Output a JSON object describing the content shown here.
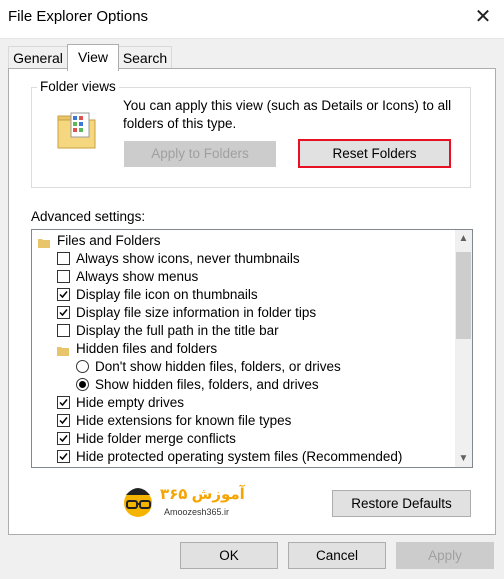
{
  "window": {
    "title": "File Explorer Options",
    "close_glyph": "✕"
  },
  "tabs": [
    {
      "label": "General",
      "active": false
    },
    {
      "label": "View",
      "active": true
    },
    {
      "label": "Search",
      "active": false
    }
  ],
  "folder_views": {
    "group_label": "Folder views",
    "description": "You can apply this view (such as Details or Icons) to all folders of this type.",
    "apply_label": "Apply to Folders",
    "reset_label": "Reset Folders",
    "highlight_color": "#e81123"
  },
  "advanced": {
    "label": "Advanced settings:",
    "items": [
      {
        "type": "folder",
        "label": "Files and Folders"
      },
      {
        "type": "checkbox",
        "label": "Always show icons, never thumbnails",
        "checked": false
      },
      {
        "type": "checkbox",
        "label": "Always show menus",
        "checked": false
      },
      {
        "type": "checkbox",
        "label": "Display file icon on thumbnails",
        "checked": true
      },
      {
        "type": "checkbox",
        "label": "Display file size information in folder tips",
        "checked": true
      },
      {
        "type": "checkbox",
        "label": "Display the full path in the title bar",
        "checked": false
      },
      {
        "type": "subfolder",
        "label": "Hidden files and folders"
      },
      {
        "type": "radio",
        "label": "Don't show hidden files, folders, or drives",
        "checked": false
      },
      {
        "type": "radio",
        "label": "Show hidden files, folders, and drives",
        "checked": true
      },
      {
        "type": "checkbox",
        "label": "Hide empty drives",
        "checked": true
      },
      {
        "type": "checkbox",
        "label": "Hide extensions for known file types",
        "checked": true
      },
      {
        "type": "checkbox",
        "label": "Hide folder merge conflicts",
        "checked": true
      },
      {
        "type": "checkbox",
        "label": "Hide protected operating system files (Recommended)",
        "checked": true
      }
    ],
    "restore_label": "Restore Defaults"
  },
  "watermark": {
    "brand_text": "آموزش ۳۶۵",
    "url_text": "Amoozesh365.ir"
  },
  "footer": {
    "ok_label": "OK",
    "cancel_label": "Cancel",
    "apply_label": "Apply"
  }
}
